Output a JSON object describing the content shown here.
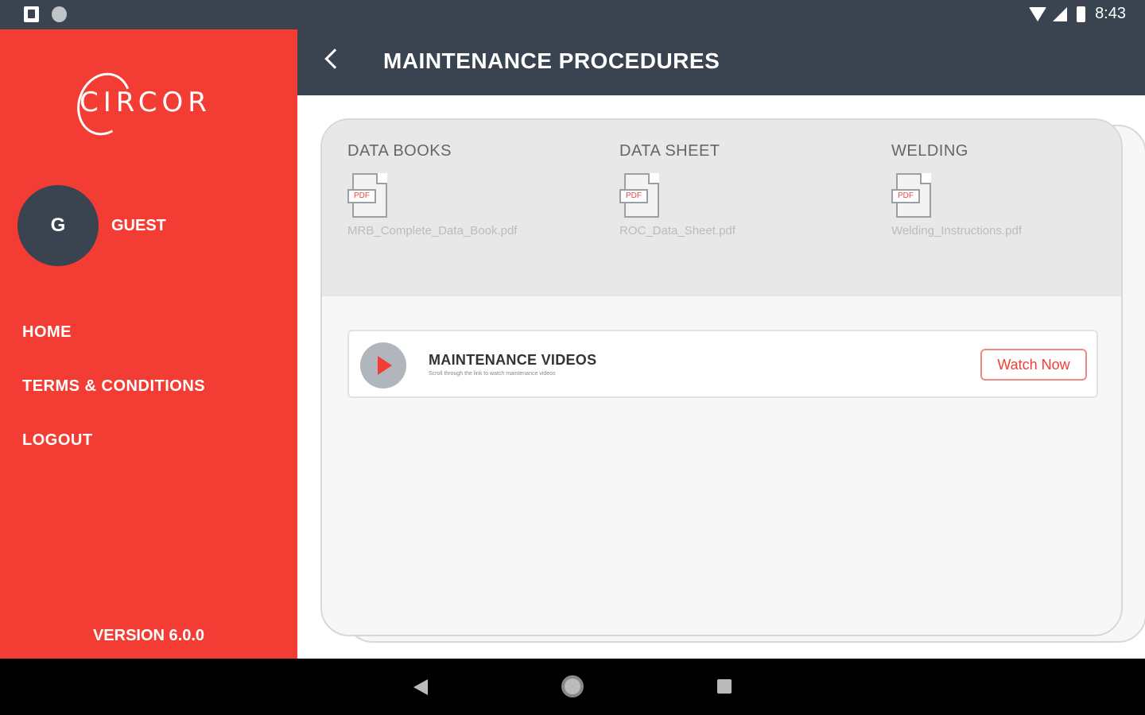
{
  "status_bar": {
    "time": "8:43",
    "icons": [
      "notification-icon",
      "circle-icon",
      "sd-card-icon",
      "wifi-icon",
      "signal-icon",
      "battery-icon"
    ]
  },
  "sidebar": {
    "brand": "CIRCOR",
    "avatar_initial": "G",
    "user_name": "GUEST",
    "nav_items": [
      {
        "label": "HOME"
      },
      {
        "label": "TERMS & CONDITIONS"
      },
      {
        "label": "LOGOUT"
      }
    ],
    "version": "VERSION 6.0.0",
    "color": "#f33d34"
  },
  "toolbar": {
    "title": "MAINTENANCE PROCEDURES",
    "color": "#3a4450"
  },
  "documents": [
    {
      "heading": "DATA BOOKS",
      "icon_tag": "PDF",
      "file": "MRB_Complete_Data_Book.pdf"
    },
    {
      "heading": "DATA SHEET",
      "icon_tag": "PDF",
      "file": "ROC_Data_Sheet.pdf"
    },
    {
      "heading": "WELDING",
      "icon_tag": "PDF",
      "file": "Welding_Instructions.pdf"
    }
  ],
  "videos": {
    "title": "MAINTENANCE VIDEOS",
    "subtitle": "Scroll through the link to watch maintenance videos",
    "button_label": "Watch Now"
  }
}
